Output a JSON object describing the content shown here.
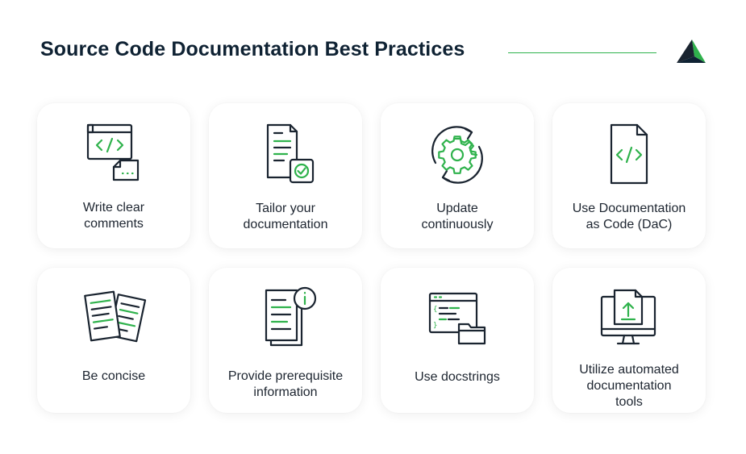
{
  "header": {
    "title": "Source Code Documentation Best Practices",
    "accent_color": "#2fb24c",
    "logo_icon": "arrow-triangle-logo-icon"
  },
  "cards": [
    {
      "label_lines": [
        "Write clear",
        "comments"
      ],
      "icon": "code-window-icon"
    },
    {
      "label_lines": [
        "Tailor your",
        "documentation"
      ],
      "icon": "document-check-icon"
    },
    {
      "label_lines": [
        "Update",
        "continuously"
      ],
      "icon": "gear-refresh-icon"
    },
    {
      "label_lines": [
        "Use Documentation",
        "as Code (DaC)"
      ],
      "icon": "code-file-icon"
    },
    {
      "label_lines": [
        "Be concise"
      ],
      "icon": "papers-icon"
    },
    {
      "label_lines": [
        "Provide prerequisite",
        "information"
      ],
      "icon": "document-info-icon"
    },
    {
      "label_lines": [
        "Use docstrings"
      ],
      "icon": "code-folder-icon"
    },
    {
      "label_lines": [
        "Utilize automated",
        "documentation",
        "tools"
      ],
      "icon": "monitor-upload-icon"
    }
  ]
}
